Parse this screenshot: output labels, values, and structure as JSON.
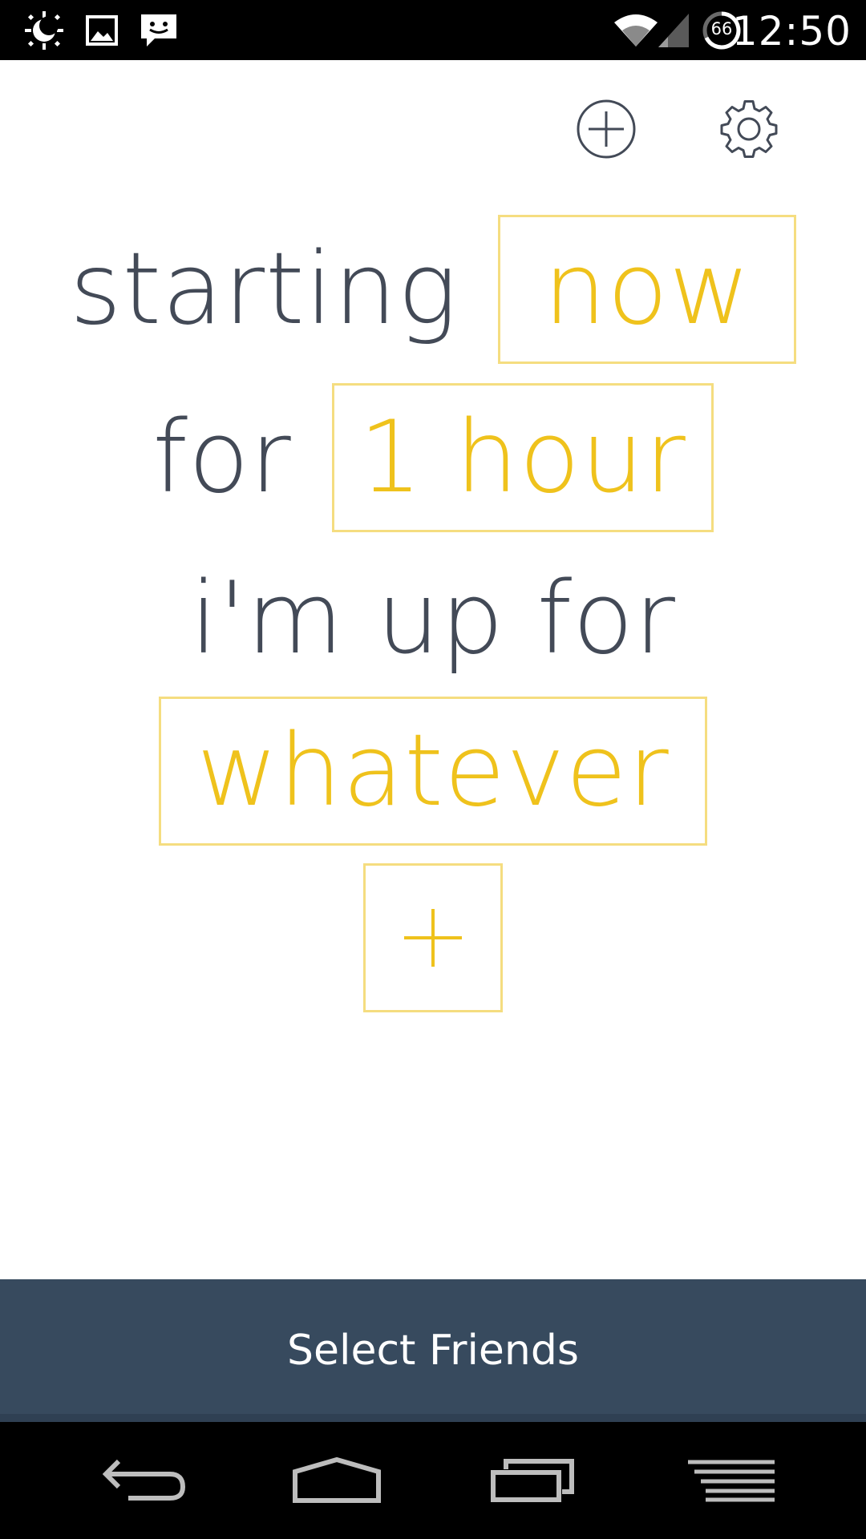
{
  "status_bar": {
    "time": "12:50",
    "battery_level": "66",
    "icons": [
      "weather-night-icon",
      "image-icon",
      "message-icon",
      "wifi-icon",
      "signal-icon",
      "battery-icon"
    ]
  },
  "header": {
    "icons": [
      "add-circle-icon",
      "settings-gear-icon"
    ]
  },
  "phrase": {
    "line1_static": "starting",
    "start_value": "now",
    "line2_static": "for",
    "duration_value": "1 hour",
    "line3_static": "i'm up for",
    "activity_value": "whatever",
    "add_activity_symbol": "+"
  },
  "footer": {
    "select_friends_label": "Select Friends"
  },
  "nav_bar": {
    "icons": [
      "back-icon",
      "home-icon",
      "recent-apps-icon",
      "menu-icon"
    ]
  },
  "colors": {
    "accent": "#efc21c",
    "accent_border": "#f5dd80",
    "text": "#434a57",
    "button_bg": "#374a5e"
  }
}
